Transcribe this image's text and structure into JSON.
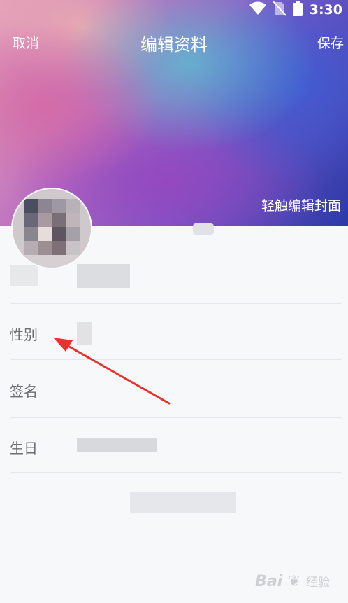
{
  "status_bar": {
    "time": "3:30",
    "icons": [
      "wifi-icon",
      "no-sim-icon",
      "battery-icon"
    ]
  },
  "nav": {
    "cancel_label": "取消",
    "title": "编辑资料",
    "save_label": "保存"
  },
  "cover": {
    "edit_label": "轻触编辑封面"
  },
  "profile_rows": [
    {
      "label": "性别"
    },
    {
      "label": "签名"
    },
    {
      "label": "生日"
    }
  ],
  "watermark": {
    "text": "Bai",
    "suffix": "经验"
  },
  "colors": {
    "row_label": "#6e6e72",
    "background": "#f7f8fa",
    "annotation_arrow": "#e8322e"
  }
}
